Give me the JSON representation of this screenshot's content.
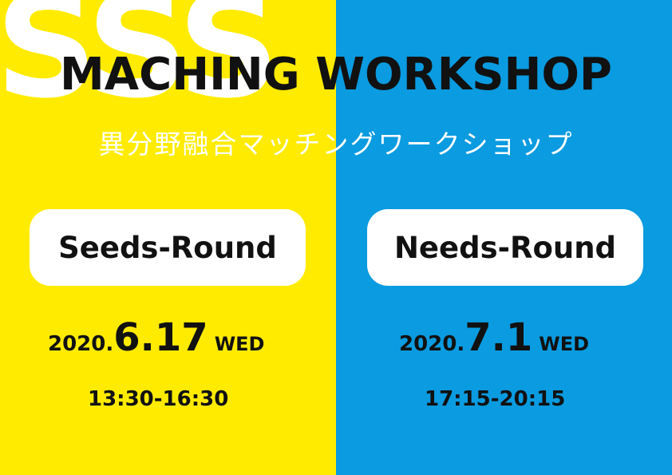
{
  "colors": {
    "left_bg": "#FFEB00",
    "right_bg": "#0A9BE0"
  },
  "decor": {
    "bg_letters": "SSS"
  },
  "title": "MACHING WORKSHOP",
  "subtitle": "異分野融合マッチングワークショップ",
  "sessions": [
    {
      "round": "Seeds-Round",
      "year": "2020.",
      "month_day": "6.17",
      "weekday": "WED",
      "time": "13:30-16:30"
    },
    {
      "round": "Needs-Round",
      "year": "2020.",
      "month_day": "7.1",
      "weekday": "WED",
      "time": "17:15-20:15"
    }
  ]
}
